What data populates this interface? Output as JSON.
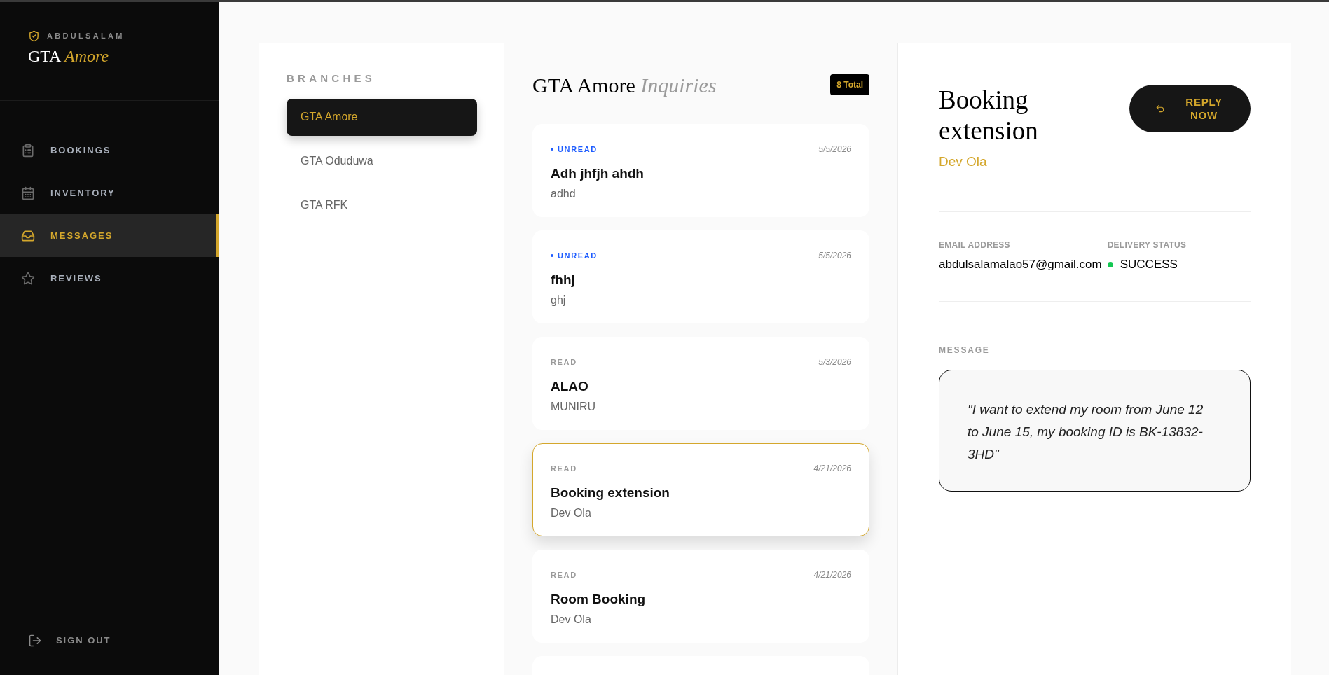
{
  "sidebar": {
    "eyebrow": "ABDULSALAM",
    "brand": "GTA",
    "brand_accent": "Amore",
    "nav": [
      {
        "label": "BOOKINGS",
        "selected": false
      },
      {
        "label": "INVENTORY",
        "selected": false
      },
      {
        "label": "MESSAGES",
        "selected": true
      },
      {
        "label": "REVIEWS",
        "selected": false
      }
    ],
    "sign_out": "SIGN OUT"
  },
  "branches": {
    "heading": "BRANCHES",
    "items": [
      {
        "label": "GTA Amore",
        "selected": true
      },
      {
        "label": "GTA Oduduwa",
        "selected": false
      },
      {
        "label": "GTA RFK",
        "selected": false
      }
    ]
  },
  "inquiries": {
    "title": "GTA Amore",
    "title_accent": "Inquiries",
    "total": "8 Total",
    "messages": [
      {
        "status": "UNREAD",
        "unread": true,
        "date": "5/5/2026",
        "subject": "Adh jhfjh ahdh",
        "sender": "adhd",
        "selected": false
      },
      {
        "status": "UNREAD",
        "unread": true,
        "date": "5/5/2026",
        "subject": "fhhj",
        "sender": "ghj",
        "selected": false
      },
      {
        "status": "READ",
        "unread": false,
        "date": "5/3/2026",
        "subject": "ALAO",
        "sender": "MUNIRU",
        "selected": false
      },
      {
        "status": "READ",
        "unread": false,
        "date": "4/21/2026",
        "subject": "Booking extension",
        "sender": "Dev Ola",
        "selected": true
      },
      {
        "status": "READ",
        "unread": false,
        "date": "4/21/2026",
        "subject": "Room Booking",
        "sender": "Dev Ola",
        "selected": false
      }
    ]
  },
  "detail": {
    "title": "Booking extension",
    "sender": "Dev Ola",
    "reply_button": "REPLY NOW",
    "fields": [
      {
        "label": "EMAIL ADDRESS",
        "value": "abdulsalamalao57@gmail.com",
        "kind": "text"
      },
      {
        "label": "DELIVERY STATUS",
        "value": "SUCCESS",
        "kind": "status"
      }
    ],
    "message_label": "MESSAGE",
    "message": "\"I want to extend my room from June 12 to June 15, my booking ID is BK-13832-3HD\""
  }
}
